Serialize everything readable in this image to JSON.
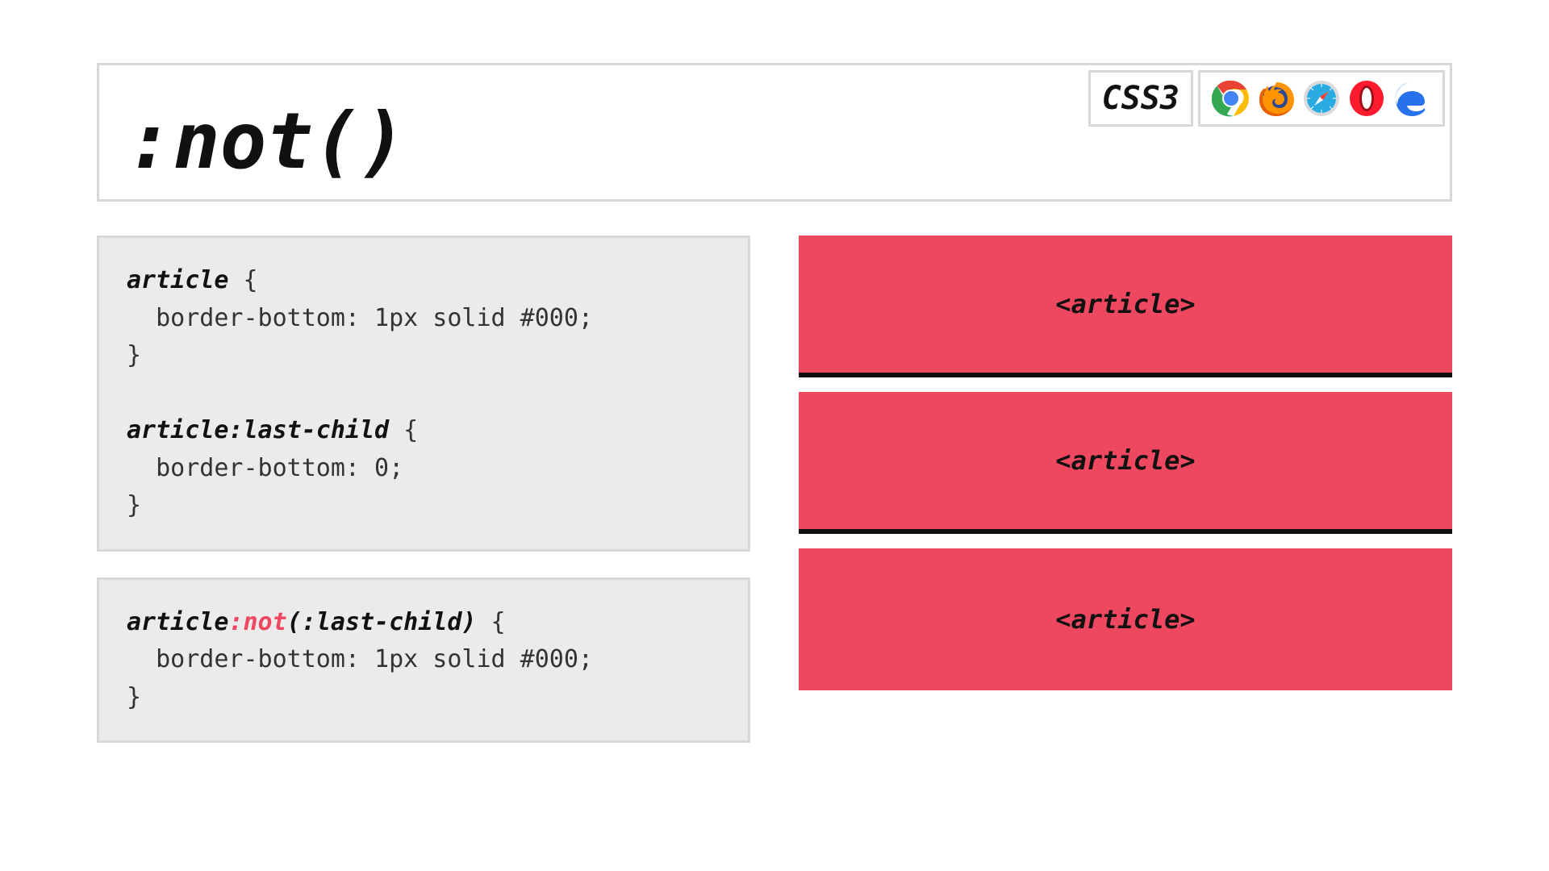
{
  "header": {
    "title": ":not()",
    "css_badge": "CSS3",
    "browsers": [
      "chrome",
      "firefox",
      "safari",
      "opera",
      "edge"
    ]
  },
  "code_blocks": [
    {
      "id": "traditional",
      "lines": [
        {
          "parts": [
            {
              "t": "article",
              "cls": "sel"
            },
            {
              "t": " {"
            }
          ]
        },
        {
          "parts": [
            {
              "t": "  border-bottom: 1px solid #000;"
            }
          ]
        },
        {
          "parts": [
            {
              "t": "}"
            }
          ]
        },
        {
          "parts": [
            {
              "t": ""
            }
          ]
        },
        {
          "parts": [
            {
              "t": "article:last-child",
              "cls": "sel"
            },
            {
              "t": " {"
            }
          ]
        },
        {
          "parts": [
            {
              "t": "  border-bottom: 0;"
            }
          ]
        },
        {
          "parts": [
            {
              "t": "}"
            }
          ]
        }
      ]
    },
    {
      "id": "not",
      "lines": [
        {
          "parts": [
            {
              "t": "article",
              "cls": "sel"
            },
            {
              "t": ":not",
              "cls": "sel hl"
            },
            {
              "t": "(:last-child)",
              "cls": "sel"
            },
            {
              "t": " {"
            }
          ]
        },
        {
          "parts": [
            {
              "t": "  border-bottom: 1px solid #000;"
            }
          ]
        },
        {
          "parts": [
            {
              "t": "}"
            }
          ]
        }
      ]
    }
  ],
  "articles": [
    "<article>",
    "<article>",
    "<article>"
  ],
  "colors": {
    "accent": "#ee4860",
    "panel_bg": "#ebebeb",
    "panel_border": "#d8d8d8"
  }
}
